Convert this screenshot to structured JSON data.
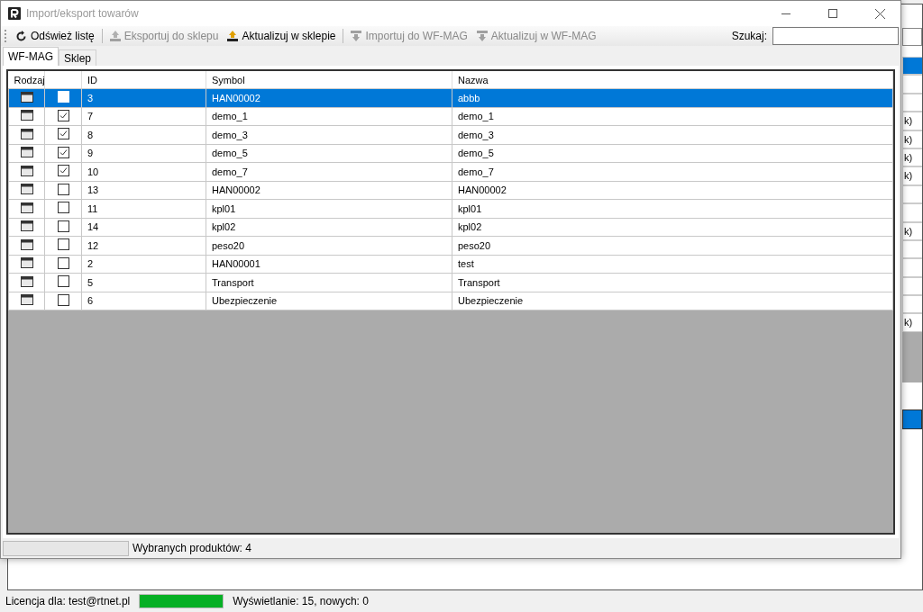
{
  "background_window": {
    "side_cells": [
      {
        "text": "",
        "selected": true
      },
      {
        "text": "",
        "selected": false
      },
      {
        "text": "",
        "selected": false
      },
      {
        "text": "k)",
        "selected": false
      },
      {
        "text": "k)",
        "selected": false
      },
      {
        "text": "k)",
        "selected": false
      },
      {
        "text": "k)",
        "selected": false
      },
      {
        "text": "",
        "selected": false
      },
      {
        "text": "",
        "selected": false
      },
      {
        "text": "k)",
        "selected": false
      },
      {
        "text": "",
        "selected": false
      },
      {
        "text": "",
        "selected": false
      },
      {
        "text": "",
        "selected": false
      },
      {
        "text": "",
        "selected": false
      },
      {
        "text": "k)",
        "selected": false
      }
    ],
    "status_bar": {
      "license": "Licencja dla: test@rtnet.pl",
      "level": 1,
      "info": "Wyświetlanie: 15, nowych: 0"
    }
  },
  "window": {
    "title": "Import/eksport towarów"
  },
  "toolbar": [
    {
      "kind": "refresh",
      "label": "Odśwież listę",
      "disabled": false
    },
    {
      "kind": "separator"
    },
    {
      "kind": "export",
      "label": "Eksportuj do sklepu",
      "disabled": true
    },
    {
      "kind": "export",
      "label": "Aktualizuj w sklepie",
      "disabled": false
    },
    {
      "kind": "separator"
    },
    {
      "kind": "import",
      "label": "Importuj do WF-MAG",
      "disabled": true
    },
    {
      "kind": "import",
      "label": "Aktualizuj w WF-MAG",
      "disabled": true
    }
  ],
  "search": {
    "label": "Szukaj:"
  },
  "tabs": [
    {
      "label": "WF-MAG",
      "selected": true
    },
    {
      "label": "Sklep",
      "selected": false
    }
  ],
  "table": {
    "columns": [
      "Rodzaj",
      "",
      "ID",
      "Symbol",
      "Nazwa"
    ],
    "rows": [
      {
        "checked": false,
        "selected": true,
        "id": "3",
        "symbol": "HAN00002",
        "name": "abbb"
      },
      {
        "checked": true,
        "selected": false,
        "id": "7",
        "symbol": "demo_1",
        "name": "demo_1"
      },
      {
        "checked": true,
        "selected": false,
        "id": "8",
        "symbol": "demo_3",
        "name": "demo_3"
      },
      {
        "checked": true,
        "selected": false,
        "id": "9",
        "symbol": "demo_5",
        "name": "demo_5"
      },
      {
        "checked": true,
        "selected": false,
        "id": "10",
        "symbol": "demo_7",
        "name": "demo_7"
      },
      {
        "checked": false,
        "selected": false,
        "id": "13",
        "symbol": "HAN00002",
        "name": "HAN00002"
      },
      {
        "checked": false,
        "selected": false,
        "id": "11",
        "symbol": "kpl01",
        "name": "kpl01"
      },
      {
        "checked": false,
        "selected": false,
        "id": "14",
        "symbol": "kpl02",
        "name": "kpl02"
      },
      {
        "checked": false,
        "selected": false,
        "id": "12",
        "symbol": "peso20",
        "name": "peso20"
      },
      {
        "checked": false,
        "selected": false,
        "id": "2",
        "symbol": "HAN00001",
        "name": "test"
      },
      {
        "checked": false,
        "selected": false,
        "id": "5",
        "symbol": "Transport",
        "name": "Transport"
      },
      {
        "checked": false,
        "selected": false,
        "id": "6",
        "symbol": "Ubezpieczenie",
        "name": "Ubezpieczenie"
      }
    ]
  },
  "status_bar": {
    "level": 0,
    "text": "Wybranych produktów: 4"
  }
}
